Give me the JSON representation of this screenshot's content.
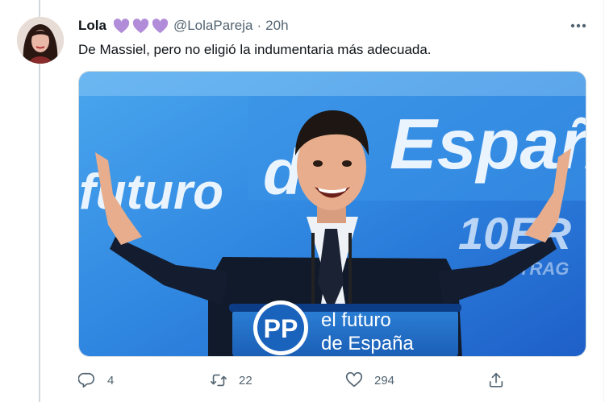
{
  "tweet": {
    "author_name": "Lola",
    "handle": "@LolaPareja",
    "separator": "·",
    "time": "20h",
    "text": "De Massiel, pero no eligió la indumentaria más adecuada.",
    "badge_icons": [
      "purple-heart-icon",
      "purple-heart-icon",
      "purple-heart-icon"
    ],
    "badge_color": "#b18cd9"
  },
  "media": {
    "banner_text": "el futuro de España",
    "banner_words": [
      "futuro",
      "de",
      "Españ"
    ],
    "podium_logo": "PP",
    "podium_line1": "el futuro",
    "podium_line2": "de España",
    "side_text": "10ER",
    "side_text2": "TRAG"
  },
  "actions": {
    "reply_count": "4",
    "retweet_count": "22",
    "like_count": "294",
    "icons": [
      "reply-icon",
      "retweet-icon",
      "like-icon",
      "share-icon"
    ]
  }
}
